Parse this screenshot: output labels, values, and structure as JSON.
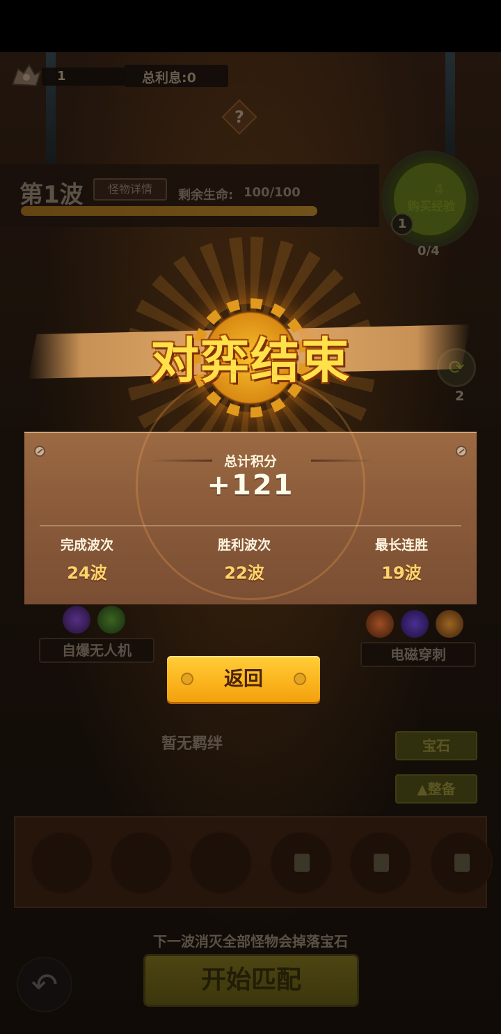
{
  "hud": {
    "level": "1",
    "interest": "总利息:0",
    "help_icon": "?"
  },
  "wave": {
    "title": "第1波",
    "monster_details": "怪物详情",
    "life_label": "剩余生命:",
    "life_value": "100/100",
    "progress": 1.0
  },
  "exp": {
    "count": "4",
    "label": "购买经验",
    "level": "1",
    "progress": "0/4"
  },
  "refresh": {
    "count": "2"
  },
  "result": {
    "title": "对弈结束",
    "score_label": "总计积分",
    "score_value": "+121",
    "stats": [
      {
        "label": "完成波次",
        "value": "24波"
      },
      {
        "label": "胜利波次",
        "value": "22波"
      },
      {
        "label": "最长连胜",
        "value": "19波"
      }
    ],
    "return_button": "返回"
  },
  "board": {
    "left_tag": "自爆无人机",
    "right_tag": "电磁穿刺",
    "bond_text": "暂无羁绊",
    "gem_button": "宝石",
    "equip_button": "▲整备",
    "hint": "下一波消灭全部怪物会掉落宝石",
    "start_button": "开始匹配"
  },
  "colors": {
    "accent_gold": "#ffce3a",
    "title_yellow": "#ffe14a",
    "panel_brown": "#8c5c3b",
    "stat_value": "#ffd36a"
  }
}
